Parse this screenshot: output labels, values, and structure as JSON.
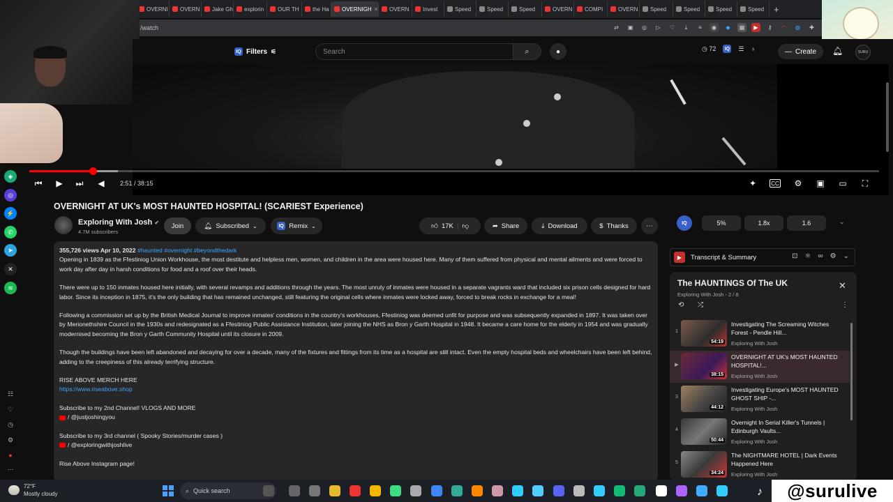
{
  "browser": {
    "tabs": [
      {
        "label": "OVERNI",
        "active": false
      },
      {
        "label": "OVERN",
        "active": false
      },
      {
        "label": "Jake Gh",
        "active": false
      },
      {
        "label": "explorin",
        "active": false
      },
      {
        "label": "OUR TH",
        "active": false
      },
      {
        "label": "the Ha",
        "active": false
      },
      {
        "label": "OVERNIGH",
        "active": true
      },
      {
        "label": "OVERN",
        "active": false
      },
      {
        "label": "Invest",
        "active": false
      },
      {
        "label": "Speed",
        "active": false
      },
      {
        "label": "Speed",
        "active": false
      },
      {
        "label": "Speed",
        "active": false
      },
      {
        "label": "OVERN",
        "active": false
      },
      {
        "label": "COMPI",
        "active": false
      },
      {
        "label": "OVERN",
        "active": false
      },
      {
        "label": "Speed",
        "active": false
      },
      {
        "label": "Speed",
        "active": false
      },
      {
        "label": "Speed",
        "active": false
      },
      {
        "label": "Speed",
        "active": false
      }
    ],
    "new_tab": "+",
    "url": "/watch"
  },
  "header": {
    "filters_label": "Filters",
    "filters_badge": "IQ",
    "search_placeholder": "Search",
    "search_icon": "search-icon",
    "mic_icon": "mic-icon",
    "counter": "72",
    "create_label": "Create",
    "avatar_text": "SURU"
  },
  "player": {
    "time": "2:51 / 38:15",
    "progress_fraction": 0.0745,
    "buffered_fraction": 0.104
  },
  "video": {
    "title": "OVERNIGHT AT UK's MOST HAUNTED HOSPITAL! (SCARIEST Experience)",
    "channel_name": "Exploring With Josh",
    "verified": "✔",
    "subscribers": "4.7M subscribers",
    "join_label": "Join",
    "subscribed_label": "Subscribed",
    "remix_label": "Remix",
    "likes": "17K",
    "share_label": "Share",
    "download_label": "Download",
    "thanks_label": "Thanks",
    "more": "⋯"
  },
  "description": {
    "meta": "355,726 views  Apr 10, 2022",
    "tags": "#haunted #overnight #beyondthedark",
    "paragraphs": [
      "Opening in 1839 as the Ffestiniog Union Workhouse, the most destitute and helpless men, women, and children in the area were housed here. Many of them suffered from physical and mental ailments and were forced to work day after day in harsh conditions for food and a roof over their heads.",
      "There were up to 150 inmates housed here initially, with several revamps and additions through the years. The most unruly of inmates were housed in a separate vagrants ward that included six prison cells designed for hard labor. Since its inception in 1875, it's the only building that has remained unchanged, still featuring the original cells where inmates were locked away, forced to break rocks in exchange for a meal!",
      "Following a commission set up by the British Medical Journal to improve inmates' conditions in the country's workhouses, Ffestiniog was deemed unfit for purpose and was subsequently expanded in 1897. It was taken over by Merionethshire Council in the 1930s and redesignated as a Ffestiniog Public Assistance Institution, later joining the NHS as Bron y Garth Hospital in 1948. It became a care home for the elderly in 1954 and was gradually modernised becoming the Bron y Garth Community Hospital until its closure in 2009.",
      "Though the buildings have been left abandoned and decaying for over a decade, many of the fixtures and fittings from its time as a hospital are still intact. Even the empty hospital beds and wheelchairs have been left behind, adding to the creepiness of this already terrifying structure."
    ],
    "merch_heading": "RISE ABOVE MERCH HERE",
    "merch_link": "https://www.riseabove.shop",
    "second_channel_text": "Subscribe to my 2nd Channel! VLOGS AND MORE",
    "second_channel_handle": "/ @justjoshingyou",
    "third_channel_text": "Subscribe to my 3rd channel ( Spooky Stories/murder cases )",
    "third_channel_handle": "/ @exploringwithjoshlive",
    "instagram_text": "Rise Above Instagram page!"
  },
  "speed": {
    "logo": "IQ",
    "options": [
      "5%",
      "1.8x",
      "1.6"
    ]
  },
  "transcript": {
    "label": "Transcript & Summary"
  },
  "playlist": {
    "title": "The HAUNTINGS Of The UK",
    "subtitle": "Exploring With Josh - 2 / 8",
    "items": [
      {
        "index": "1",
        "title": "Investigating The Screaming Witches Forest - Pendle Hill...",
        "channel": "Exploring With Josh",
        "duration": "54:19"
      },
      {
        "index": "▶",
        "title": "OVERNIGHT AT UK's MOST HAUNTED HOSPITAL!...",
        "channel": "Exploring With Josh",
        "duration": "38:15"
      },
      {
        "index": "3",
        "title": "Investigating Europe's MOST HAUNTED GHOST SHIP -...",
        "channel": "Exploring With Josh",
        "duration": "44:12"
      },
      {
        "index": "4",
        "title": "Overnight In Serial Killer's Tunnels | Edinburgh Vaults...",
        "channel": "Exploring With Josh",
        "duration": "50:44"
      },
      {
        "index": "5",
        "title": "The NIGHTMARE HOTEL | Dark Events Happened Here",
        "channel": "Exploring With Josh",
        "duration": "34:24"
      }
    ]
  },
  "taskbar": {
    "temperature": "72°F",
    "weather": "Mostly cloudy",
    "search_label": "Quick search"
  },
  "overlay": {
    "brand": "@surulive"
  },
  "colors": {
    "accent_red": "#ff0000",
    "link_blue": "#3ea6ff",
    "background": "#0f0f0f"
  }
}
